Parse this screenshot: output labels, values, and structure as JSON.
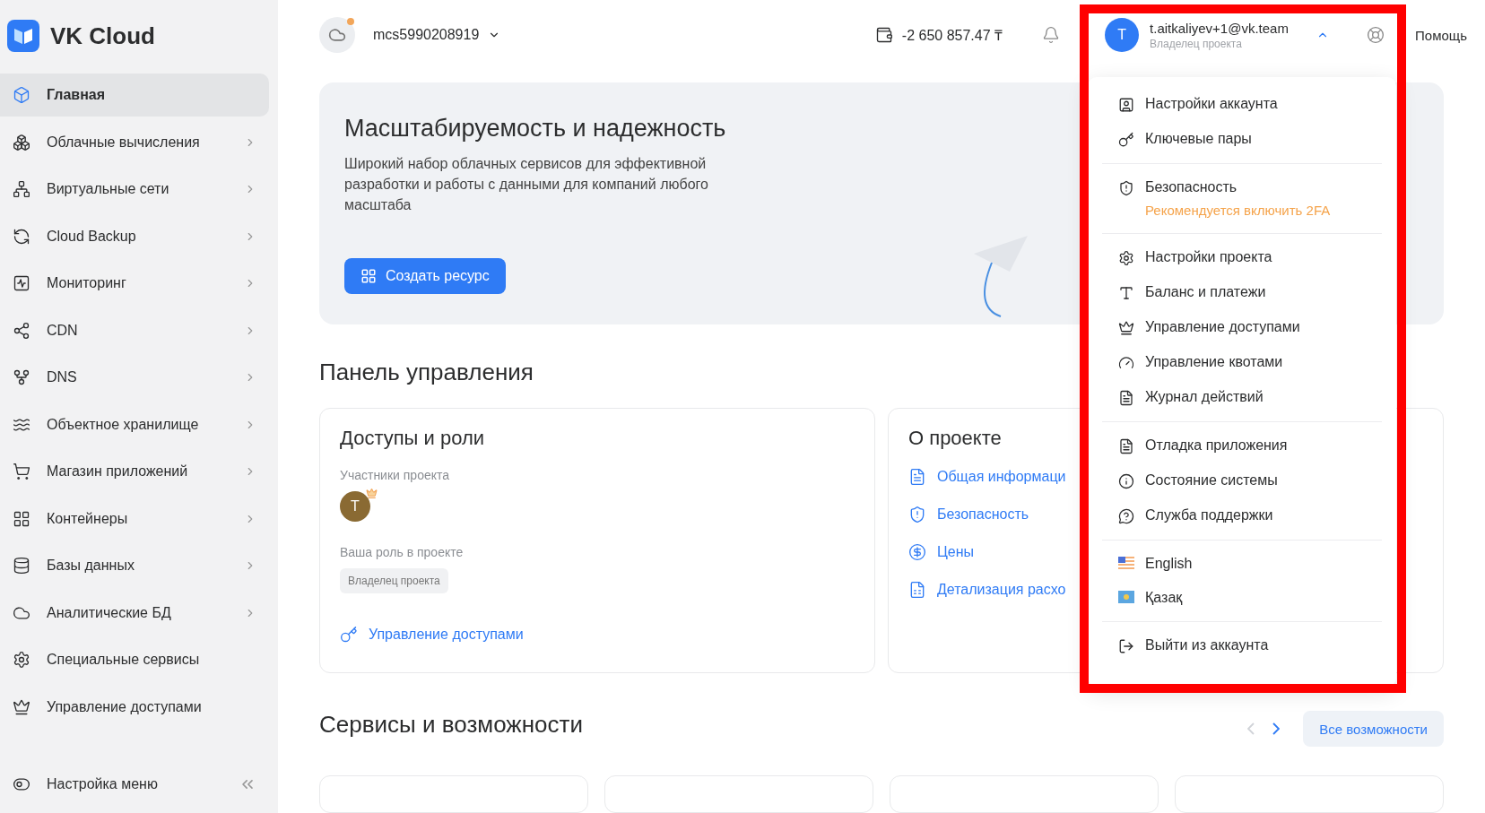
{
  "sidebar": {
    "logo": "VK Cloud",
    "items": [
      {
        "label": "Главная",
        "selected": true,
        "expandable": false
      },
      {
        "label": "Облачные вычисления",
        "selected": false,
        "expandable": true
      },
      {
        "label": "Виртуальные сети",
        "selected": false,
        "expandable": true
      },
      {
        "label": "Cloud Backup",
        "selected": false,
        "expandable": true
      },
      {
        "label": "Мониторинг",
        "selected": false,
        "expandable": true
      },
      {
        "label": "CDN",
        "selected": false,
        "expandable": true
      },
      {
        "label": "DNS",
        "selected": false,
        "expandable": true
      },
      {
        "label": "Объектное хранилище",
        "selected": false,
        "expandable": true
      },
      {
        "label": "Магазин приложений",
        "selected": false,
        "expandable": true
      },
      {
        "label": "Контейнеры",
        "selected": false,
        "expandable": true
      },
      {
        "label": "Базы данных",
        "selected": false,
        "expandable": true
      },
      {
        "label": "Аналитические БД",
        "selected": false,
        "expandable": true
      },
      {
        "label": "Специальные сервисы",
        "selected": false,
        "expandable": false
      },
      {
        "label": "Управление доступами",
        "selected": false,
        "expandable": false
      }
    ],
    "footer": "Настройка меню"
  },
  "topbar": {
    "project": "mcs5990208919",
    "balance": "-2 650 857.47 ₸",
    "user": {
      "initial": "T",
      "email": "t.aitkaliyev+1@vk.team",
      "role": "Владелец проекта"
    },
    "help": "Помощь"
  },
  "user_menu": {
    "groups": [
      [
        {
          "kind": "link",
          "label": "Настройки аккаунта"
        },
        {
          "kind": "link",
          "label": "Ключевые пары"
        }
      ],
      [
        {
          "kind": "link",
          "label": "Безопасность",
          "note": "Рекомендуется включить 2FA"
        }
      ],
      [
        {
          "kind": "link",
          "label": "Настройки проекта"
        },
        {
          "kind": "link",
          "label": "Баланс и платежи"
        },
        {
          "kind": "link",
          "label": "Управление доступами"
        },
        {
          "kind": "link",
          "label": "Управление квотами"
        },
        {
          "kind": "link",
          "label": "Журнал действий"
        }
      ],
      [
        {
          "kind": "link",
          "label": "Отладка приложения"
        },
        {
          "kind": "link",
          "label": "Состояние системы"
        },
        {
          "kind": "link",
          "label": "Служба поддержки"
        }
      ],
      [
        {
          "kind": "language",
          "label": "English"
        },
        {
          "kind": "language",
          "label": "Қазақ"
        }
      ],
      [
        {
          "kind": "link",
          "label": "Выйти из аккаунта"
        }
      ]
    ]
  },
  "hero": {
    "title": "Масштабируемость и надежность",
    "text": "Широкий набор облачных сервисов для эффективной разработки и работы с данными для компаний любого масштаба",
    "button": "Создать ресурс"
  },
  "dashboard": {
    "title": "Панель управления",
    "access_card": {
      "title": "Доступы и роли",
      "members_label": "Участники проекта",
      "members": [
        {
          "initial": "T",
          "owner": true
        }
      ],
      "role_label": "Ваша роль в проекте",
      "role": "Владелец проекта",
      "link": "Управление доступами"
    },
    "project_card": {
      "title": "О проекте",
      "links": [
        "Общая информаци",
        "Безопасность",
        "Цены",
        "Детализация расхо"
      ]
    }
  },
  "services": {
    "title": "Сервисы и возможности",
    "nav": [
      {
        "kind": "prev",
        "disabled": true
      },
      {
        "kind": "next",
        "disabled": false
      }
    ],
    "button": "Все возможности"
  }
}
